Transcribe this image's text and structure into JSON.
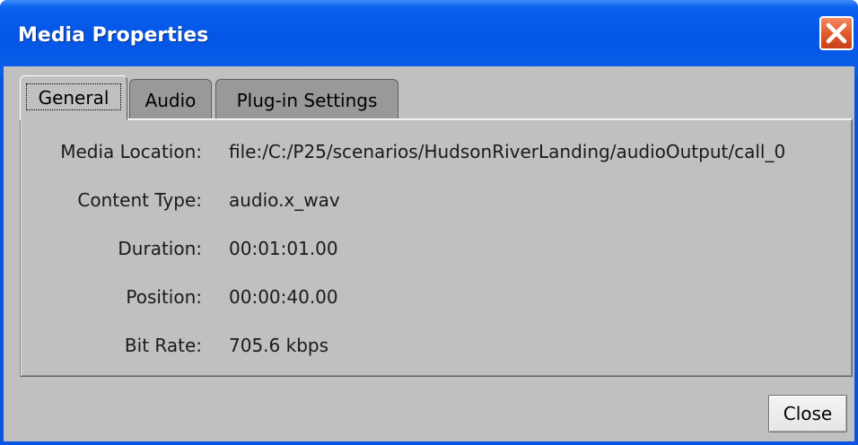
{
  "window": {
    "title": "Media Properties",
    "close_icon": "close-x-icon"
  },
  "tabs": [
    {
      "label": "General",
      "active": true
    },
    {
      "label": "Audio",
      "active": false
    },
    {
      "label": "Plug-in Settings",
      "active": false
    }
  ],
  "properties": [
    {
      "label": "Media Location:",
      "value": "file:/C:/P25/scenarios/HudsonRiverLanding/audioOutput/call_0"
    },
    {
      "label": "Content Type:",
      "value": "audio.x_wav"
    },
    {
      "label": "Duration:",
      "value": "00:01:01.00"
    },
    {
      "label": "Position:",
      "value": "00:00:40.00"
    },
    {
      "label": "Bit Rate:",
      "value": "705.6 kbps"
    }
  ],
  "footer": {
    "close_label": "Close"
  },
  "colors": {
    "titlebar": "#0A5FE8",
    "dialog_background": "#C0C0C0",
    "close_x": "#E25B2B"
  }
}
